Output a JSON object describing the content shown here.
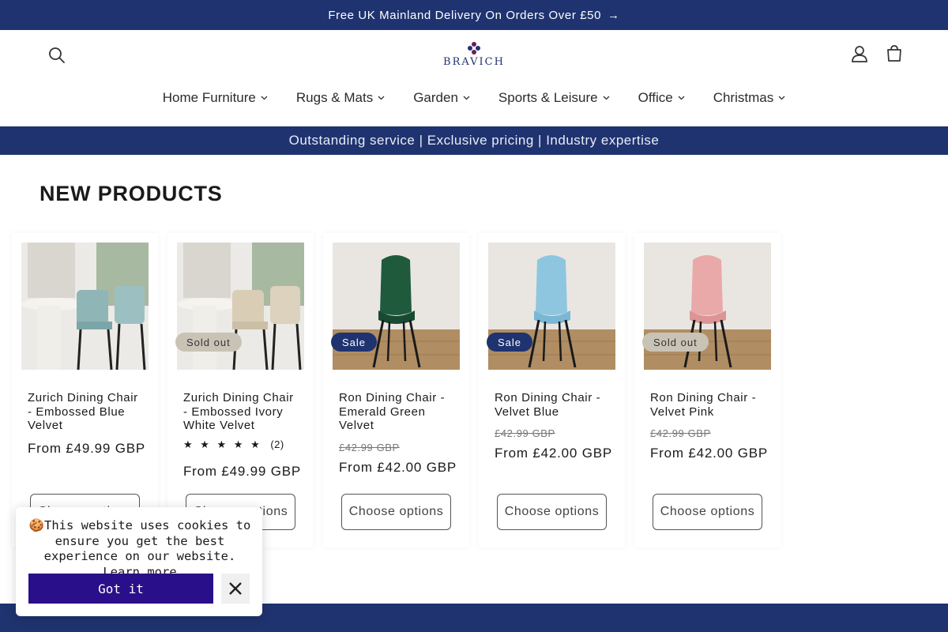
{
  "announcement": {
    "text": "Free UK Mainland Delivery On Orders Over £50",
    "arrow_icon": "arrow-right-icon"
  },
  "header": {
    "logo_text": "BRAVICH",
    "icons": {
      "search": "search-icon",
      "account": "account-icon",
      "cart": "cart-icon"
    }
  },
  "nav": {
    "items": [
      {
        "label": "Home Furniture"
      },
      {
        "label": "Rugs & Mats"
      },
      {
        "label": "Garden"
      },
      {
        "label": "Sports & Leisure"
      },
      {
        "label": "Office"
      },
      {
        "label": "Christmas"
      }
    ]
  },
  "banner": {
    "text": "Outstanding service | Exclusive pricing | Industry expertise"
  },
  "section": {
    "title": "NEW PRODUCTS"
  },
  "products": [
    {
      "title": "Zurich Dining Chair - Embossed Blue Velvet",
      "badge": "",
      "rating_stars": "",
      "rating_count": "",
      "old_price": "",
      "price": "From £49.99 GBP",
      "button": "Choose options"
    },
    {
      "title": "Zurich Dining Chair - Embossed Ivory White Velvet",
      "badge": "Sold out",
      "rating_stars": "★ ★ ★ ★ ★",
      "rating_count": "(2)",
      "old_price": "",
      "price": "From £49.99 GBP",
      "button": "Choose options"
    },
    {
      "title": "Ron Dining Chair - Emerald Green Velvet",
      "badge": "Sale",
      "rating_stars": "",
      "rating_count": "",
      "old_price": "£42.99 GBP",
      "price": "From £42.00 GBP",
      "button": "Choose options"
    },
    {
      "title": "Ron Dining Chair - Velvet Blue",
      "badge": "Sale",
      "rating_stars": "",
      "rating_count": "",
      "old_price": "£42.99 GBP",
      "price": "From £42.00 GBP",
      "button": "Choose options"
    },
    {
      "title": "Ron Dining Chair - Velvet Pink",
      "badge": "Sold out",
      "rating_stars": "",
      "rating_count": "",
      "old_price": "£42.99 GBP",
      "price": "From £42.00 GBP",
      "button": "Choose options"
    }
  ],
  "cookie": {
    "message": "This website uses cookies to ensure you get the best experience on our website.",
    "link": "Learn more",
    "accept": "Got it",
    "icon": "cookie-icon",
    "close_icon": "close-icon"
  },
  "colors": {
    "brand_navy": "#1f3370",
    "cookie_button": "#2a0f8a",
    "sale_badge": "#1f3370",
    "sold_badge": "#c9c3b6"
  }
}
